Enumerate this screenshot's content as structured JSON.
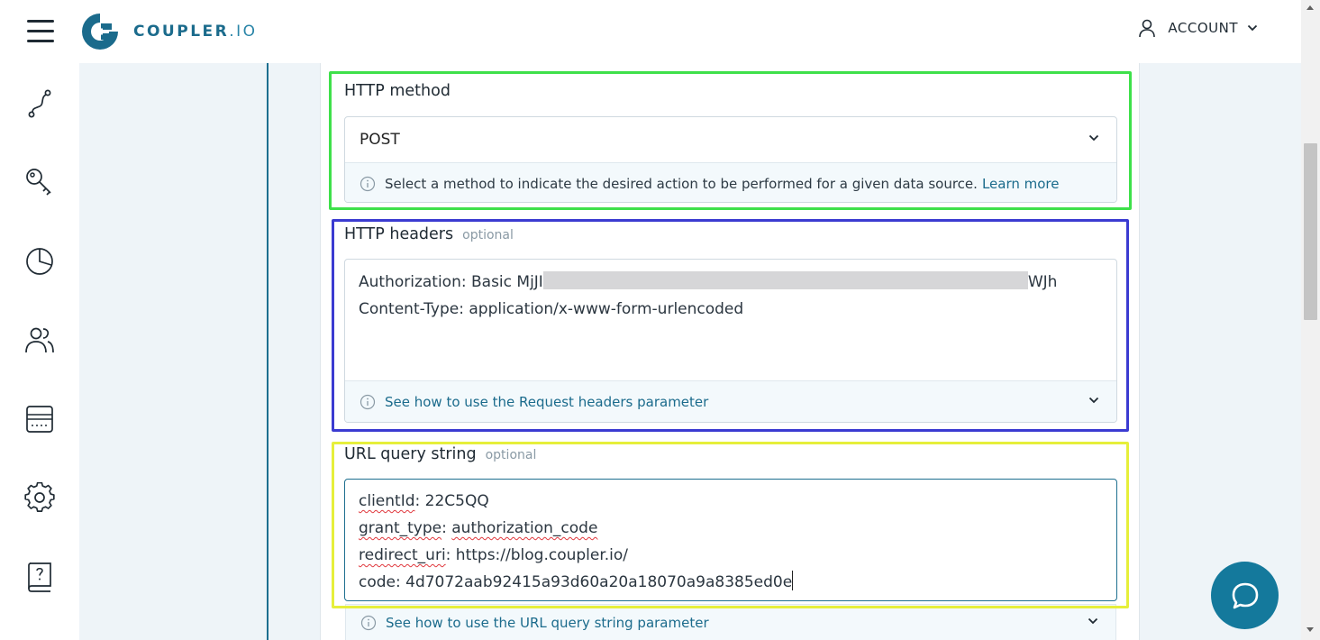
{
  "brand": {
    "name": "COUPLER",
    "suffix": ".IO",
    "colors": {
      "primary": "#1b6b8c",
      "accent": "#14799c"
    }
  },
  "header": {
    "menu_icon": "hamburger-icon",
    "account_label": "ACCOUNT"
  },
  "sidebar": {
    "items": [
      {
        "icon": "flow-icon"
      },
      {
        "icon": "key-icon"
      },
      {
        "icon": "pie-chart-icon"
      },
      {
        "icon": "users-icon"
      },
      {
        "icon": "billing-icon"
      },
      {
        "icon": "gear-icon"
      },
      {
        "icon": "help-book-icon"
      }
    ]
  },
  "http_method": {
    "label": "HTTP method",
    "value": "POST",
    "hint": "Select a method to indicate the desired action to be performed for a given data source.",
    "hint_link": "Learn more",
    "highlight_color": "#3ee04a"
  },
  "http_headers": {
    "label": "HTTP headers",
    "optional": "optional",
    "lines": {
      "auth_prefix": "Authorization: Basic MjJI",
      "auth_suffix": "WJh",
      "content_type": "Content-Type: application/x-www-form-urlencoded"
    },
    "hint": "See how to use the Request headers parameter",
    "highlight_color": "#3b3bd1"
  },
  "url_query": {
    "label": "URL query string",
    "optional": "optional",
    "lines": {
      "k1": "clientId",
      "v1": ": 22C5QQ",
      "k2": "grant_type",
      "sep2": ": ",
      "v2": "authorization_code",
      "k3": "redirect_uri",
      "v3": ": https://blog.coupler.io/",
      "l4": "code: 4d7072aab92415a93d60a20a18070a9a8385ed0e"
    },
    "hint": "See how to use the URL query string parameter",
    "highlight_color": "#e6ef3a"
  },
  "chat": {
    "icon": "chat-icon"
  }
}
